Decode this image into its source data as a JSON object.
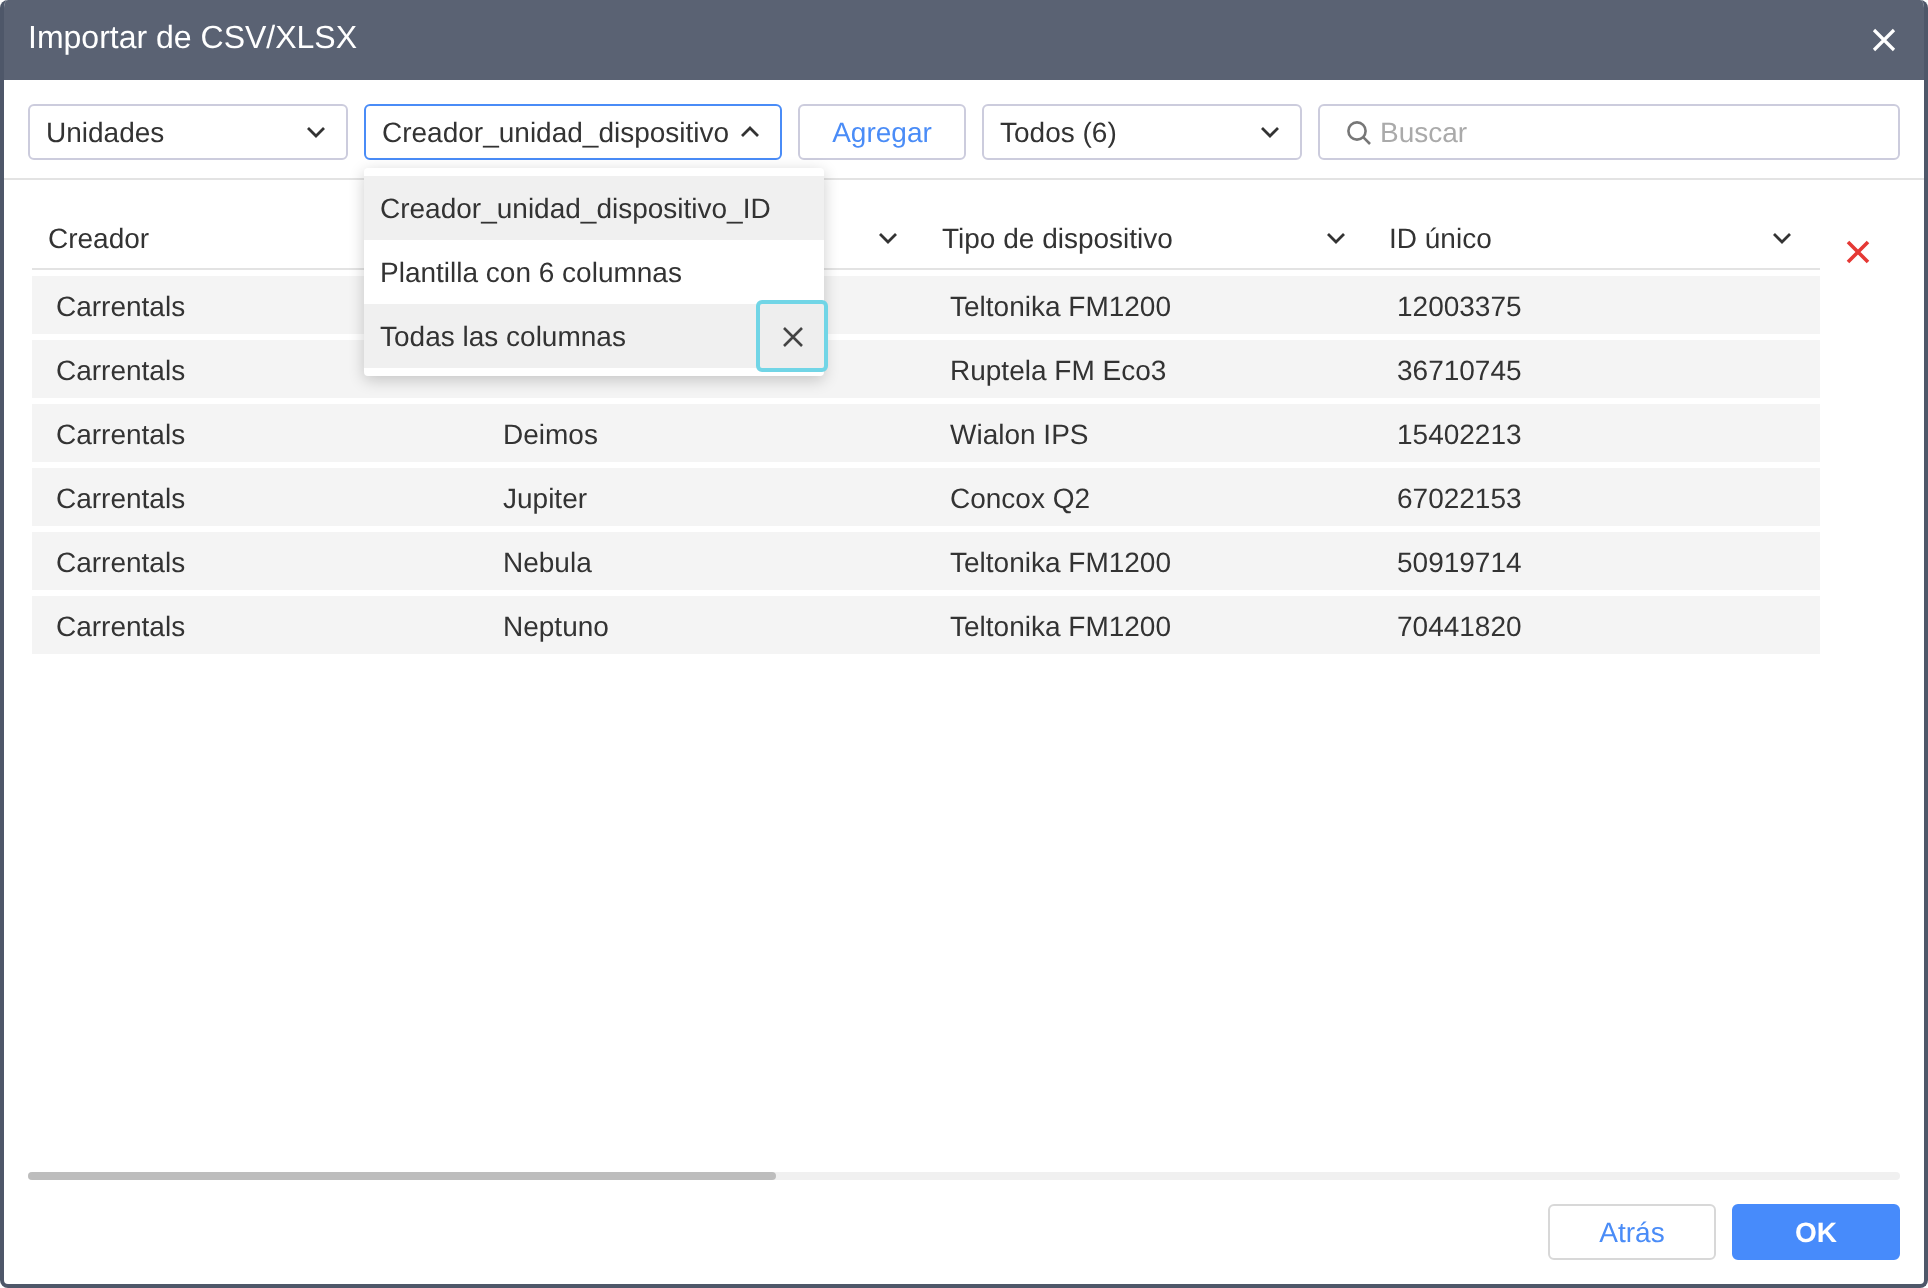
{
  "window": {
    "title": "Importar de CSV/XLSX"
  },
  "toolbar": {
    "type_select": {
      "value": "Unidades",
      "expanded": false
    },
    "template_select": {
      "value": "Creador_unidad_dispositivo",
      "expanded": true,
      "options": [
        {
          "label": "Creador_unidad_dispositivo_ID",
          "selected": true,
          "hovered": false
        },
        {
          "label": "Plantilla con 6 columnas",
          "selected": false,
          "hovered": false
        },
        {
          "label": "Todas las columnas",
          "selected": false,
          "hovered": true
        }
      ]
    },
    "add_button": "Agregar",
    "filter_select": {
      "value": "Todos (6)",
      "expanded": false
    },
    "search": {
      "placeholder": "Buscar"
    }
  },
  "table": {
    "columns": [
      {
        "label": "Creador"
      },
      {},
      {
        "label": "Tipo de dispositivo"
      },
      {
        "label": "ID único"
      }
    ],
    "rows": [
      {
        "cells": [
          "Carrentals",
          null,
          "Teltonika FM1200",
          "12003375"
        ]
      },
      {
        "cells": [
          "Carrentals",
          null,
          "Ruptela FM Eco3",
          "36710745"
        ]
      },
      {
        "cells": [
          "Carrentals",
          "Deimos",
          "Wialon IPS",
          "15402213"
        ]
      },
      {
        "cells": [
          "Carrentals",
          "Jupiter",
          "Concox Q2",
          "67022153"
        ]
      },
      {
        "cells": [
          "Carrentals",
          "Nebula",
          "Teltonika FM1200",
          "50919714"
        ]
      },
      {
        "cells": [
          "Carrentals",
          "Neptuno",
          "Teltonika FM1200",
          "70441820"
        ]
      }
    ]
  },
  "buttons": [
    {
      "label": "Atrás",
      "kind": "secondary"
    },
    {
      "label": "OK",
      "kind": "primary"
    }
  ]
}
